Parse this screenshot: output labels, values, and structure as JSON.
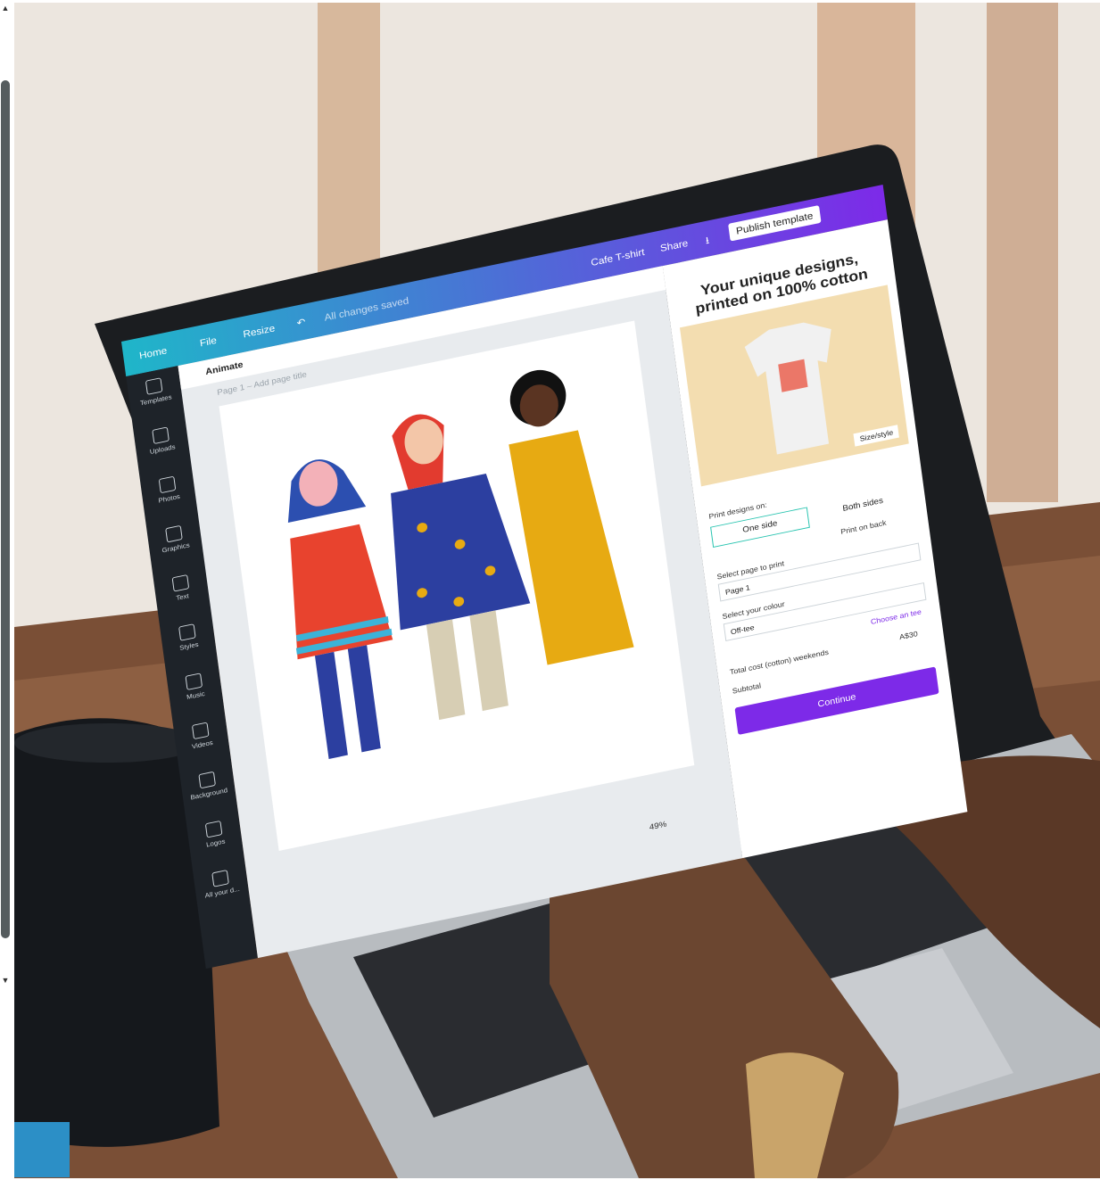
{
  "scrollbar": {
    "up_arrow": "▲",
    "down_arrow": "▼"
  },
  "canva": {
    "topbar": {
      "home": "Home",
      "file": "File",
      "resize": "Resize",
      "undo_icon": "undo-icon",
      "saved": "All changes saved",
      "doc_title": "Cafe T-shirt",
      "share": "Share",
      "publish": "Publish template"
    },
    "animate": "Animate",
    "page_label": "Page 1 – Add page title",
    "sidebar": [
      {
        "label": "Templates",
        "icon": "templates-icon"
      },
      {
        "label": "Uploads",
        "icon": "uploads-icon"
      },
      {
        "label": "Photos",
        "icon": "photos-icon"
      },
      {
        "label": "Graphics",
        "icon": "graphics-icon"
      },
      {
        "label": "Text",
        "icon": "text-icon"
      },
      {
        "label": "Styles",
        "icon": "styles-icon"
      },
      {
        "label": "Music",
        "icon": "music-icon"
      },
      {
        "label": "Videos",
        "icon": "videos-icon"
      },
      {
        "label": "Background",
        "icon": "background-icon"
      },
      {
        "label": "Logos",
        "icon": "logos-icon"
      },
      {
        "label": "All your d...",
        "icon": "folder-icon"
      }
    ],
    "zoom": "49%",
    "panel": {
      "heading": "Your unique designs, printed on 100% cotton",
      "size_select": "Size/style",
      "print_label": "Print designs on:",
      "one_side": "One side",
      "both_sides": "Both sides",
      "print_on_back": "Print on back",
      "page_label": "Select page to print",
      "page_value": "Page 1",
      "colour_label": "Select your colour",
      "colour_value": "Off-tee",
      "colour_link": "Choose an tee",
      "total_label": "Total cost (cotton) weekends",
      "total_value": "A$30",
      "subtotal": "Subtotal",
      "continue": "Continue"
    }
  },
  "colors": {
    "topbar_start": "#1fb6c9",
    "topbar_end": "#7d2ae8",
    "continue_button": "#7d2ae8",
    "sidebar_bg": "#1e2329",
    "figure1_dress": "#e8432e",
    "figure2_dress": "#2c3fa0",
    "figure3_dress": "#e7aa12"
  }
}
